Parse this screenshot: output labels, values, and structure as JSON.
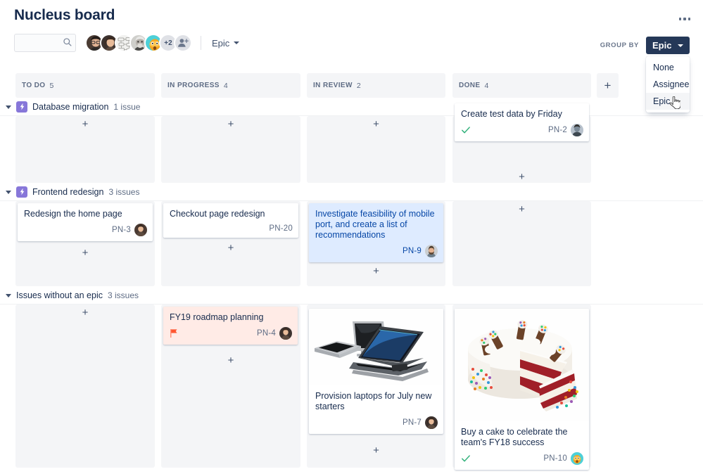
{
  "header": {
    "board_title": "Nucleus board",
    "more_label": "more-options",
    "search_placeholder": "",
    "search_value": "",
    "avatar_overflow": "+2",
    "epic_filter_label": "Epic"
  },
  "groupby": {
    "label": "GROUP BY",
    "selected": "Epic",
    "options": [
      "None",
      "Assignee",
      "Epic"
    ]
  },
  "columns": [
    {
      "name": "TO DO",
      "count": "5"
    },
    {
      "name": "IN PROGRESS",
      "count": "4"
    },
    {
      "name": "IN REVIEW",
      "count": "2"
    },
    {
      "name": "DONE",
      "count": "4"
    }
  ],
  "add_column_label": "+",
  "add_card_label": "+",
  "swimlanes": [
    {
      "title": "Database migration",
      "count": "1 issue",
      "has_epic_badge": true,
      "cards": {
        "done": {
          "title": "Create test data by Friday",
          "key": "PN-2",
          "done": true,
          "avatar": "avatar-dark"
        }
      }
    },
    {
      "title": "Frontend redesign",
      "count": "3 issues",
      "has_epic_badge": true,
      "cards": {
        "todo": {
          "title": "Redesign the home page",
          "key": "PN-3",
          "avatar": "avatar-woman-2"
        },
        "inprogress": {
          "title": "Checkout page redesign",
          "key": "PN-20",
          "avatar": null
        },
        "inreview": {
          "title": "Investigate feasibility of mobile port, and create a list of recommendations",
          "key": "PN-9",
          "selected": true,
          "avatar": "avatar-beard"
        }
      }
    },
    {
      "title": "Issues without an epic",
      "count": "3 issues",
      "has_epic_badge": false,
      "cards": {
        "inprogress": {
          "title": "FY19 roadmap planning",
          "key": "PN-4",
          "flagged": true,
          "avatar": "avatar-woman-1"
        },
        "inreview": {
          "title": "Provision laptops for July new starters",
          "key": "PN-7",
          "cover": "laptops",
          "avatar": "avatar-woman-1"
        },
        "done": {
          "title": "Buy a cake to celebrate the team's FY18 success",
          "key": "PN-10",
          "cover": "cake",
          "done": true,
          "avatar": "avatar-emoji"
        }
      }
    }
  ],
  "colors": {
    "epic_badge": "#8777d9",
    "groupby_button": "#253858",
    "selected_card": "#deebff",
    "flagged_card": "#ffebe6",
    "column_track": "#f4f5f7",
    "done_check": "#36b37e",
    "flag": "#ff5630"
  }
}
